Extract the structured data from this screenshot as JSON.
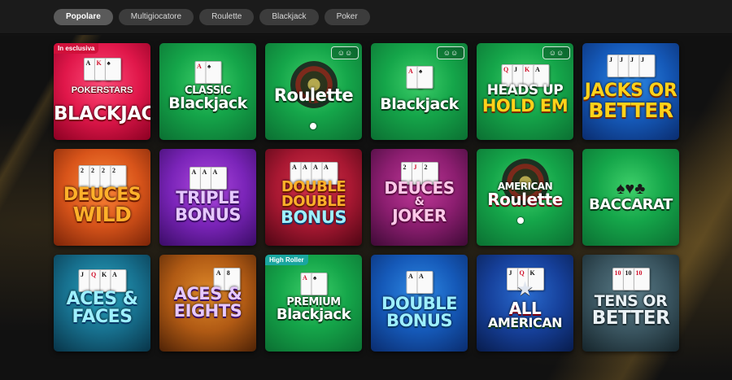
{
  "tabs": [
    {
      "label": "Popolare",
      "active": true
    },
    {
      "label": "Multigiocatore",
      "active": false
    },
    {
      "label": "Roulette",
      "active": false
    },
    {
      "label": "Blackjack",
      "active": false
    },
    {
      "label": "Poker",
      "active": false
    }
  ],
  "games": [
    {
      "badge": "In esclusiva",
      "brand": "POKERSTARS",
      "title": [
        "BLACKJACK"
      ],
      "theme": "red",
      "icon": "pokerstars-blackjack-logo"
    },
    {
      "title": [
        "CLASSIC",
        "Blackjack"
      ],
      "theme": "green",
      "icon": "cards-icon"
    },
    {
      "title": [
        "Roulette"
      ],
      "theme": "green",
      "multiplayer": true,
      "icon": "roulette-wheel-icon"
    },
    {
      "title": [
        "Blackjack"
      ],
      "theme": "green",
      "multiplayer": true,
      "icon": "cards-icon"
    },
    {
      "title": [
        "HEADS UP",
        "HOLD EM"
      ],
      "theme": "green",
      "multiplayer": true,
      "icon": "cards-icon"
    },
    {
      "title": [
        "JACKS OR",
        "BETTER"
      ],
      "theme": "blue",
      "icon": "cards-icon"
    },
    {
      "title": [
        "DEUCES",
        "WILD"
      ],
      "theme": "orange",
      "icon": "cards-icon"
    },
    {
      "title": [
        "TRIPLE",
        "BONUS"
      ],
      "theme": "purple",
      "icon": "cards-icon"
    },
    {
      "title": [
        "DOUBLE",
        "DOUBLE",
        "BONUS"
      ],
      "theme": "crimson",
      "icon": "cards-icon"
    },
    {
      "title": [
        "DEUCES",
        "&",
        "JOKER"
      ],
      "theme": "magenta",
      "icon": "cards-icon"
    },
    {
      "title": [
        "AMERICAN",
        "Roulette"
      ],
      "theme": "green",
      "icon": "roulette-wheel-icon"
    },
    {
      "title": [
        "BACCARAT"
      ],
      "theme": "green",
      "icon": "card-suits-icon"
    },
    {
      "title": [
        "ACES &",
        "FACES"
      ],
      "theme": "teal",
      "icon": "cards-icon"
    },
    {
      "title": [
        "ACES &",
        "EIGHTS"
      ],
      "theme": "amber",
      "icon": "cards-icon"
    },
    {
      "badge": "High Roller",
      "title": [
        "PREMIUM",
        "Blackjack"
      ],
      "theme": "green",
      "icon": "cards-icon"
    },
    {
      "title": [
        "DOUBLE",
        "BONUS"
      ],
      "theme": "blue",
      "icon": "cards-icon"
    },
    {
      "title": [
        "ALL",
        "AMERICAN"
      ],
      "theme": "navy",
      "icon": "star-icon"
    },
    {
      "title": [
        "TENS OR",
        "BETTER"
      ],
      "theme": "slate",
      "icon": "cards-icon"
    }
  ]
}
